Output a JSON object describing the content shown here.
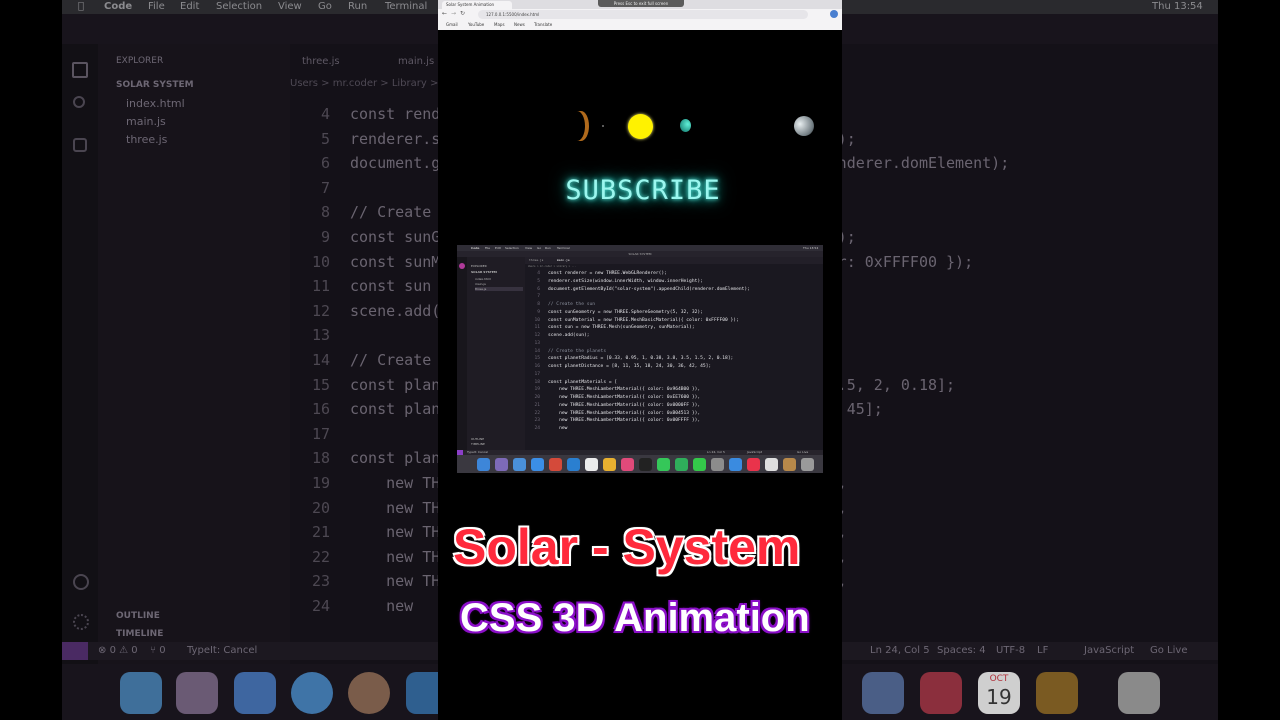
{
  "background": {
    "menubar": {
      "app": "Code",
      "items": [
        "File",
        "Edit",
        "Selection",
        "View",
        "Go",
        "Run",
        "Terminal"
      ],
      "clock": "Thu 13:54"
    },
    "explorer": {
      "title": "EXPLORER",
      "folder": "SOLAR SYSTEM",
      "files": [
        "index.html",
        "main.js",
        "three.js"
      ],
      "outline": "OUTLINE",
      "timeline": "TIMELINE"
    },
    "editor": {
      "tabs": [
        "three.js",
        "main.js"
      ],
      "breadcrumb": "Users > mr.coder > Library > ...",
      "lines": [
        {
          "n": "4",
          "t": "const renderer = new THREE.WebGLRenderer();"
        },
        {
          "n": "5",
          "t": "renderer.setSize(window.innerWidth, window.innerHeight);"
        },
        {
          "n": "6",
          "t": "document.getElementById(\"solar-system\").appendChild(renderer.domElement);"
        },
        {
          "n": "7",
          "t": ""
        },
        {
          "n": "8",
          "t": "// Create the sun"
        },
        {
          "n": "9",
          "t": "const sunGeometry = new THREE.SphereGeometry(5, 32, 32);"
        },
        {
          "n": "10",
          "t": "const sunMaterial = new THREE.MeshBasicMaterial({ color: 0xFFFF00 });"
        },
        {
          "n": "11",
          "t": "const sun = new THREE.Mesh(sunGeometry, sunMaterial);"
        },
        {
          "n": "12",
          "t": "scene.add(sun);"
        },
        {
          "n": "13",
          "t": ""
        },
        {
          "n": "14",
          "t": "// Create the planets"
        },
        {
          "n": "15",
          "t": "const planetRadius = [0.33, 0.95, 1, 0.38, 3.8, 3.5, 1.5, 2, 0.18];"
        },
        {
          "n": "16",
          "t": "const planetDistance = [8, 11, 15, 18, 24, 30, 36, 42, 45];"
        },
        {
          "n": "17",
          "t": ""
        },
        {
          "n": "18",
          "t": "const planetMaterials = ["
        },
        {
          "n": "19",
          "t": "    new THREE.MeshLambertMaterial({ color: 0x964B00 }),"
        },
        {
          "n": "20",
          "t": "    new THREE.MeshLambertMaterial({ color: 0xEE7600 }),"
        },
        {
          "n": "21",
          "t": "    new THREE.MeshLambertMaterial({ color: 0x0000FF }),"
        },
        {
          "n": "22",
          "t": "    new THREE.MeshLambertMaterial({ color: 0xB04513 }),"
        },
        {
          "n": "23",
          "t": "    new THREE.MeshLambertMaterial({ color: 0x00FFFF }),"
        },
        {
          "n": "24",
          "t": "    new "
        }
      ]
    },
    "statusbar": {
      "errors": "0",
      "warnings": "0",
      "ports": "0",
      "typeit": "TypeIt: Cancel",
      "position": "Ln 24, Col 5",
      "spaces": "Spaces: 4",
      "encoding": "UTF-8",
      "eol": "LF",
      "language": "JavaScript",
      "golive": "Go Live"
    },
    "dock_calendar": {
      "month": "OCT",
      "day": "19"
    }
  },
  "browser": {
    "tab_title": "Solar System Animation",
    "url": "127.0.0.1:5500/index.html",
    "bookmarks": [
      "Gmail",
      "YouTube",
      "Maps",
      "News",
      "Translate"
    ],
    "fullscreen_banner": "Press Esc to exit full screen"
  },
  "scene": {
    "subscribe_text": "SUBSCRIBE",
    "colors": {
      "sun": "#fff200",
      "planet_cyan": "#19c7b0",
      "planet_grey": "#b9c3c7",
      "glow": "#22d6c7"
    }
  },
  "titles": {
    "line1": "Solar - System",
    "line2": "CSS 3D Animation",
    "colors": {
      "line1": "#ff2a3c",
      "line1_outline": "#ffffff",
      "line2": "#ffffff",
      "line2_outline": "#8b0fc8"
    }
  }
}
